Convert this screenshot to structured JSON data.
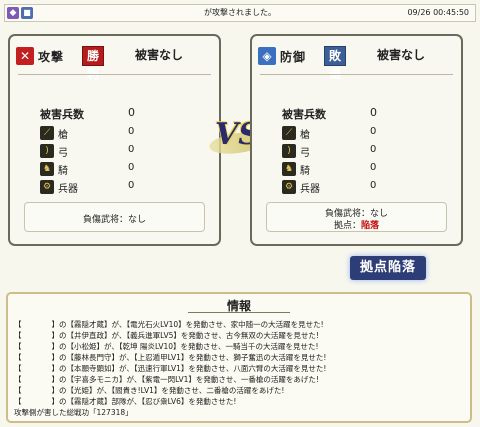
{
  "header": {
    "icon1": "purple-square-icon",
    "icon2": "blue-book-icon",
    "message": "が攻撃されました。",
    "timestamp": "09/26 00:45:50"
  },
  "attack": {
    "kanji": "攻撃",
    "result": "勝利",
    "damage": "被害なし",
    "losses_label": "被害兵数",
    "losses_value": "0",
    "rows": [
      {
        "label": "槍",
        "value": "0",
        "icon": "spear-icon"
      },
      {
        "label": "弓",
        "value": "0",
        "icon": "bow-icon"
      },
      {
        "label": "騎",
        "value": "0",
        "icon": "horse-icon"
      },
      {
        "label": "兵器",
        "value": "0",
        "icon": "siege-weapon-icon"
      }
    ],
    "injured": "負傷武将：なし"
  },
  "defense": {
    "kanji": "防御",
    "result": "敗退",
    "damage": "被害なし",
    "losses_label": "被害兵数",
    "losses_value": "0",
    "rows": [
      {
        "label": "槍",
        "value": "0",
        "icon": "spear-icon"
      },
      {
        "label": "弓",
        "value": "0",
        "icon": "bow-icon"
      },
      {
        "label": "騎",
        "value": "0",
        "icon": "horse-icon"
      },
      {
        "label": "兵器",
        "value": "0",
        "icon": "siege-weapon-icon"
      }
    ],
    "injured": "負傷武将：なし",
    "base_label": "拠点：",
    "base_value": "陥落"
  },
  "vs_text": "VS",
  "stamp": "拠点陥落",
  "log": {
    "title": "情報",
    "lines": [
      "【　　　　】の【霧隠才蔵】が、【電光石火LV10】を発動させ、家中随一の大活躍を見せた!",
      "【　　　　】の【井伊直政】が、【義兵進軍LV5】を発動させ、古今無双の大活躍を見せた!",
      "【　　　　】の【小松姫】が、【乾坤 陽炎LV10】を発動させ、一騎当千の大活躍を見せた!",
      "【　　　　】の【藤林長門守】が、【上忍遁甲LV1】を発動させ、獅子奮迅の大活躍を見せた!",
      "【　　　　】の【本願寺顕如】が、【迅速行軍LV1】を発動させ、八面六臂の大活躍を見せた!",
      "【　　　　】の【宇喜多モニカ】が、【紫電一閃LV1】を発動させ、一番槍の活躍をあげた!",
      "【　　　　】の【光姫】が、【閻貴き!LV1】を発動させ、二番槍の活躍をあげた!",
      "【　　　　】の【霧隠才蔵】部隊が、【忍び衆LV6】を発動させた!",
      "攻撃側が害した総戦功「127318」"
    ]
  },
  "colors": {
    "victory_red": "#b51c1c",
    "defeat_blue": "#3d5f98",
    "fall_red": "#c41010"
  }
}
